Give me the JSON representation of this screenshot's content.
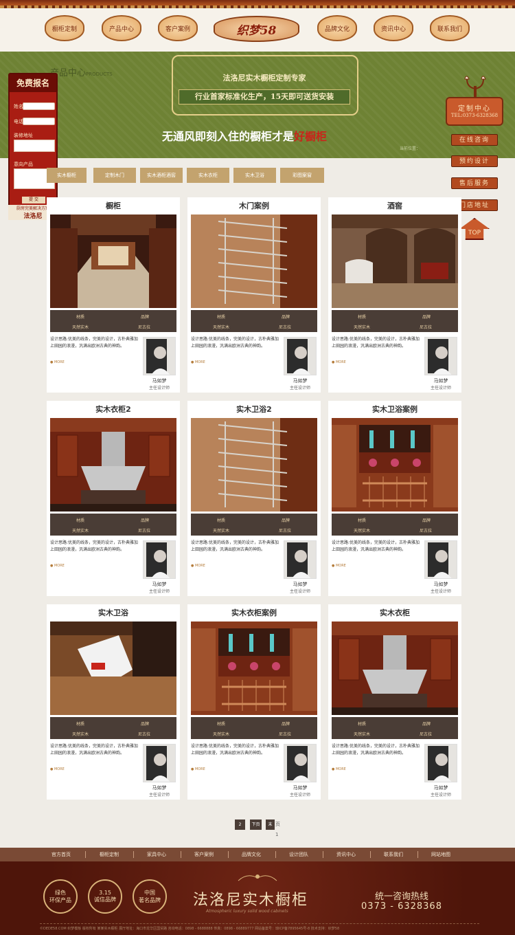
{
  "nav": {
    "left": [
      "橱柜定制",
      "产品中心",
      "客户案例"
    ],
    "logo": "织梦58",
    "right": [
      "品牌文化",
      "资讯中心",
      "联系我们"
    ]
  },
  "banner": {
    "bg_title": "产品中心",
    "bg_title_en": "PRODUCTS",
    "line1": "法洛尼实木橱柜定制专家",
    "line2": "行业首家标准化生产，15天即可送货安装",
    "slogan_main": "无通风即刻入住的橱柜才是",
    "slogan_red": "好橱柜",
    "current_position": "当前位置："
  },
  "form": {
    "title": "免费报名",
    "name_label": "姓名",
    "phone_label": "电话",
    "address_label": "装修地址",
    "product_label": "意向产品",
    "submit": "提 交",
    "bottom_small": "厨房完美解决方案",
    "bottom_brand": "法洛尼"
  },
  "rightfloat": {
    "title": "定制中心",
    "phone": "TEL:0373-6328368",
    "buttons": [
      "在线咨询",
      "预约设计",
      "售后服务",
      "门店地址"
    ],
    "top": "TOP"
  },
  "categories": [
    "实木橱柜",
    "定制木门",
    "实木酒柜酒窖",
    "实木衣柜",
    "实木卫浴",
    "彩图案窗"
  ],
  "products": [
    {
      "title": "橱柜",
      "img": "kitchen"
    },
    {
      "title": "木门案例",
      "img": "rack"
    },
    {
      "title": "酒窖",
      "img": "cellar"
    },
    {
      "title": "实木衣柜2",
      "img": "hood"
    },
    {
      "title": "实木卫浴2",
      "img": "rack"
    },
    {
      "title": "实木卫浴案例",
      "img": "shelf"
    },
    {
      "title": "实木卫浴",
      "img": "heater"
    },
    {
      "title": "实木衣柜案例",
      "img": "shelf"
    },
    {
      "title": "实木衣柜",
      "img": "hood"
    }
  ],
  "card_common": {
    "meta_label1": "材质",
    "meta_label2": "品牌",
    "meta_value1": "天然实木",
    "meta_value2": "尼古拉",
    "desc": "设计思路:优美的线条，完美的设计，古朴典雅加上田园的浪漫，汎满出欧洲古典的神韵。",
    "more": "MORE",
    "designer_name": "马如梦",
    "designer_role": "主任设计师"
  },
  "pager": {
    "page": "2",
    "prev": "下页",
    "last": "末",
    "total_text": "页 1"
  },
  "footer_nav": [
    "官方首页",
    "橱柜定制",
    "家具中心",
    "客户案例",
    "品牌文化",
    "设计团队",
    "资讯中心",
    "联系我们",
    "网站地图"
  ],
  "footer": {
    "badges": [
      {
        "l1": "绿色",
        "l2": "环保产品"
      },
      {
        "l1": "3.15",
        "l2": "诚信品牌"
      },
      {
        "l1": "中国",
        "l2": "著名品牌"
      }
    ],
    "brand": "法洛尼实木橱柜",
    "brand_sub": "Atmospheric luxury solid wood cabinets",
    "hotline_label": "统一咨询热线",
    "hotline_phone": "0373 - 6328368",
    "copyright": "©DEDE58.COM 织梦模板 版权所有    某某实木橱柜    展厅地址：海口市龙华区国贸路    咨询电话：0898 - 6688888    传真：0898 - 66889777    网站备案号：琼ICP备7895645号-8 技术支持：织梦58"
  },
  "colors": {
    "accent": "#a91d13",
    "tab": "#c3a36e",
    "dark": "#4a3d36",
    "banner": "#6e8234",
    "footer": "#5a1a0e"
  }
}
